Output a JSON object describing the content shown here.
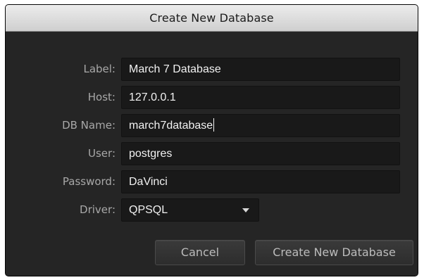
{
  "dialog": {
    "title": "Create New Database"
  },
  "form": {
    "label": {
      "label": "Label:",
      "value": "March 7 Database"
    },
    "host": {
      "label": "Host:",
      "value": "127.0.0.1"
    },
    "db_name": {
      "label": "DB Name:",
      "value": "march7database"
    },
    "user": {
      "label": "User:",
      "value": "postgres"
    },
    "password": {
      "label": "Password:",
      "value": "DaVinci"
    },
    "driver": {
      "label": "Driver:",
      "selected": "QPSQL"
    }
  },
  "buttons": {
    "cancel": "Cancel",
    "create": "Create New Database"
  },
  "icons": {
    "driver_dropdown": "chevron-down-icon"
  },
  "colors": {
    "titlebar": "#dcdcdc",
    "panel": "#252525",
    "field": "#191919",
    "label_text": "#a8a8a8",
    "field_text": "#f1f1f1"
  }
}
